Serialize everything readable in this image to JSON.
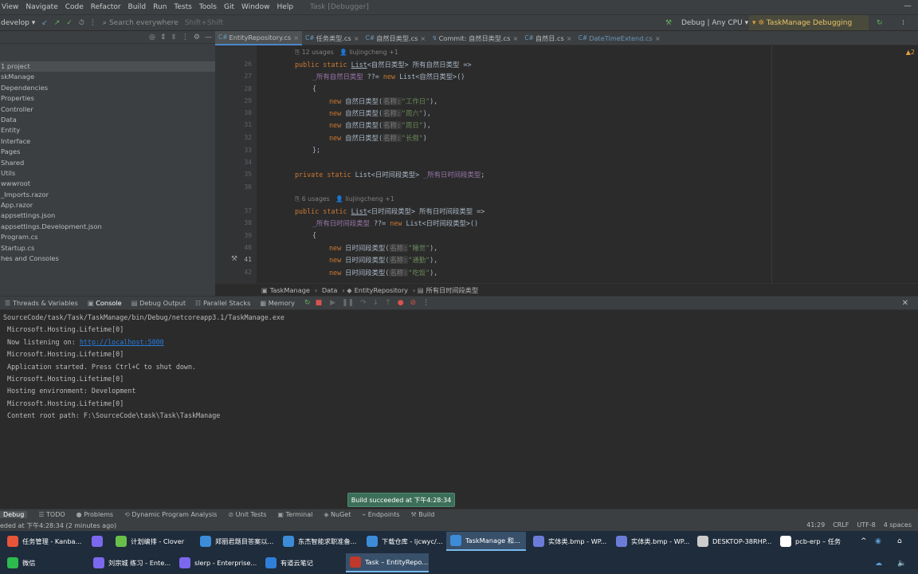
{
  "menu": {
    "items": [
      "View",
      "Navigate",
      "Code",
      "Refactor",
      "Build",
      "Run",
      "Tests",
      "Tools",
      "Git",
      "Window",
      "Help"
    ],
    "window_title": "Task [Debugger]"
  },
  "toolbar": {
    "branch": "develop",
    "search_placeholder": "Search everywhere",
    "search_shortcut": "Shift+Shift",
    "config": "Debug | Any CPU",
    "run_target": "TaskManage Debugging"
  },
  "sidebar": {
    "items": [
      {
        "label": "1 project",
        "selected": true
      },
      {
        "label": "skManage"
      },
      {
        "label": "Dependencies"
      },
      {
        "label": "Properties"
      },
      {
        "label": "Controller"
      },
      {
        "label": "Data"
      },
      {
        "label": "Entity"
      },
      {
        "label": "Interface"
      },
      {
        "label": "Pages"
      },
      {
        "label": "Shared"
      },
      {
        "label": "Utils"
      },
      {
        "label": "wwwroot"
      },
      {
        "label": "_Imports.razor"
      },
      {
        "label": "App.razor"
      },
      {
        "label": "appsettings.json"
      },
      {
        "label": "appsettings.Development.json"
      },
      {
        "label": "Program.cs"
      },
      {
        "label": "Startup.cs"
      },
      {
        "label": "hes and Consoles"
      }
    ]
  },
  "tabs": [
    {
      "prefix": "C#",
      "label": "EntityRepository.cs",
      "active": true
    },
    {
      "prefix": "C#",
      "label": "任务类型.cs"
    },
    {
      "prefix": "C#",
      "label": "自然日类型.cs"
    },
    {
      "prefix": "↯",
      "label": "Commit: 自然日类型.cs"
    },
    {
      "prefix": "C#",
      "label": "自然日.cs"
    },
    {
      "prefix": "C#",
      "label": "DateTimeExtend.cs"
    }
  ],
  "editor": {
    "warning_count": "2",
    "usage_hint_1": "12 usages",
    "author_hint_1": "liujingcheng +1",
    "usage_hint_2": "6 usages",
    "author_hint_2": "liujingcheng +1",
    "line_numbers": [
      "26",
      "27",
      "28",
      "29",
      "30",
      "31",
      "32",
      "33",
      "34",
      "35",
      "36",
      "37",
      "38",
      "39",
      "40",
      "41",
      "42"
    ]
  },
  "breadcrumb": [
    "TaskManage",
    "Data",
    "EntityRepository",
    "所有日时间段类型"
  ],
  "debug_tabs": [
    "Threads & Variables",
    "Console",
    "Debug Output",
    "Parallel Stacks",
    "Memory"
  ],
  "console": {
    "lines": [
      "SourceCode/task/Task/TaskManage/bin/Debug/netcoreapp3.1/TaskManage.exe",
      " Microsoft.Hosting.Lifetime[0]",
      " Now listening on: ",
      " Microsoft.Hosting.Lifetime[0]",
      " Application started. Press Ctrl+C to shut down.",
      " Microsoft.Hosting.Lifetime[0]",
      " Hosting environment: Development",
      " Microsoft.Hosting.Lifetime[0]",
      " Content root path: F:\\SourceCode\\task\\Task\\TaskManage"
    ],
    "link": "http://localhost:5000"
  },
  "toast": "Build succeeded at 下午4:28:34",
  "bottom_tabs": [
    "Debug",
    "TODO",
    "Problems",
    "Dynamic Program Analysis",
    "Unit Tests",
    "Terminal",
    "NuGet",
    "Endpoints",
    "Build"
  ],
  "status": {
    "left": "eded at 下午4:28:34 (2 minutes ago)",
    "position": "41:29",
    "line_ending": "CRLF",
    "encoding": "UTF-8",
    "indent": "4 spaces"
  },
  "taskbar": {
    "row1": [
      "任务管理 - Kanba...",
      "",
      "计划编排 - Clover",
      "郑丽君题目答案以...",
      "东杰智能求职准备...",
      "下载仓库 - ljcwyc/...",
      "TaskManage 和...",
      "实体类.bmp - WP...",
      "实体类.bmp - WP...",
      "DESKTOP-38RHP...",
      "pcb-erp – 任务"
    ],
    "row2": [
      "微信",
      "刘宗城 练习 - Ente...",
      "slerp - Enterprise...",
      "有道云笔记",
      "Task – EntityRepo..."
    ]
  },
  "colors": {
    "accent": "#4a88c7",
    "keyword": "#cc7832",
    "string": "#6a8759",
    "taskbar": "#1f2c3b"
  }
}
